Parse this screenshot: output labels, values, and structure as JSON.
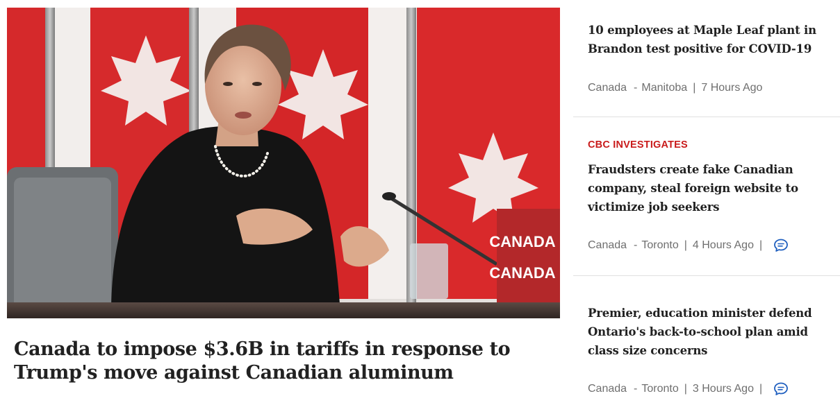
{
  "lead_story": {
    "headline": "Canada to impose $3.6B in tariffs in response to Trump's move against Canadian aluminum",
    "image": {
      "sign_text_top": "CANADA",
      "sign_text_bottom": "CANADA"
    }
  },
  "side_stories": [
    {
      "flag": "",
      "headline": "10 employees at Maple Leaf plant in Brandon test positive for COVID-19",
      "category": "Canada",
      "region": "Manitoba",
      "time": "7 Hours Ago",
      "has_comments": false
    },
    {
      "flag": "CBC INVESTIGATES",
      "headline": "Fraudsters create fake Canadian company, steal foreign website to victimize job seekers",
      "category": "Canada",
      "region": "Toronto",
      "time": "4 Hours Ago",
      "has_comments": true
    },
    {
      "flag": "",
      "headline": "Premier, education minister defend Ontario's back-to-school plan amid class size concerns",
      "category": "Canada",
      "region": "Toronto",
      "time": "3 Hours Ago",
      "has_comments": true
    }
  ],
  "meta_separators": {
    "dash": "-",
    "bar": "|"
  },
  "icons": {
    "comment": "comment-bubble-icon"
  },
  "colors": {
    "flag_red": "#c91b1b",
    "meta_gray": "#6f6f6f",
    "comment_blue": "#1f5fbf",
    "headline": "#212121"
  }
}
